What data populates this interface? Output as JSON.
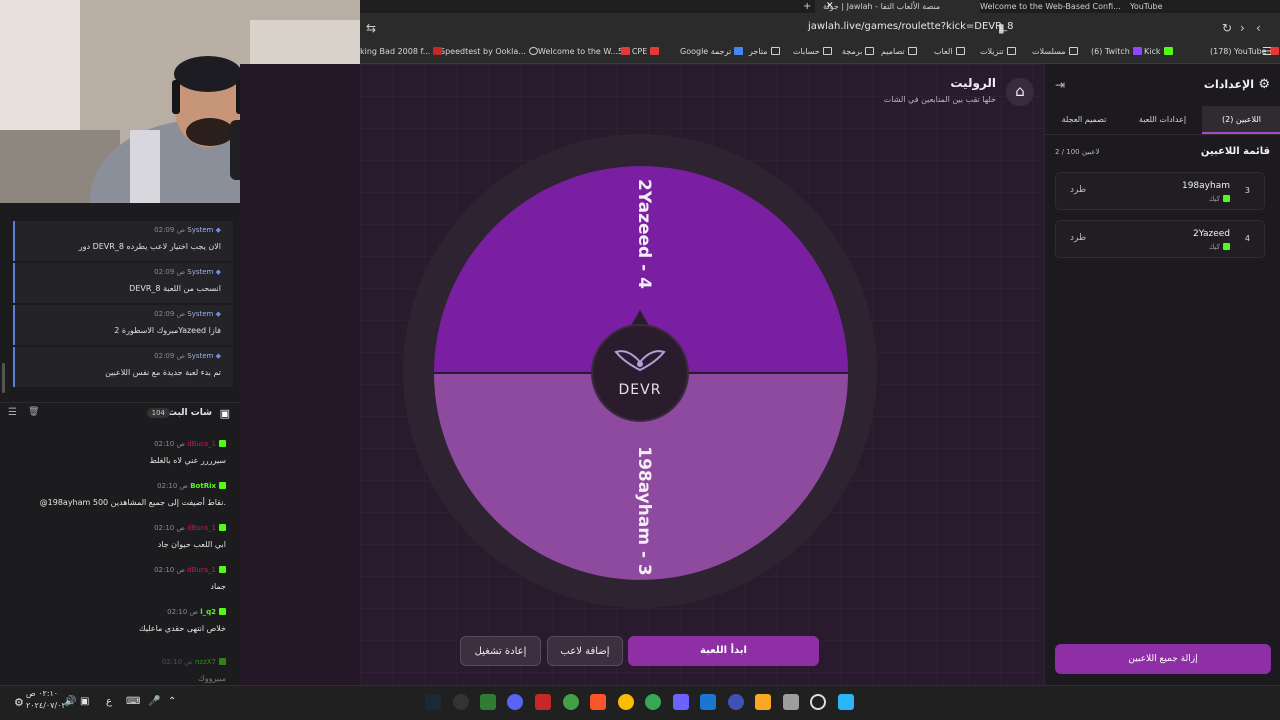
{
  "browser": {
    "tabs": [
      {
        "label": "YouTube"
      },
      {
        "label": "Welcome to the Web-Based Confi..."
      },
      {
        "label": "جولة | Jawlah - منصة الألعاب التفا"
      },
      {
        "label": "+"
      }
    ],
    "url": "jawlah.live/games/roulette?kick=DEVR_8",
    "bookmarks": [
      "(178) YouTube",
      "Kick",
      "(6) Twitch",
      "مسلسلات",
      "تنزيلات",
      "العاب",
      "تصاميم",
      "برمجة",
      "حسابات",
      "متاجر",
      "Google ترجمة",
      "5G CPE",
      "Welcome to the W...",
      "Speedtest by Ookla...",
      "king Bad 2008 f..."
    ]
  },
  "system_messages": [
    {
      "user": "System",
      "time": "02:09 ص",
      "text": "دور DEVR_8 الان يجب اختيار لاعب يطرده"
    },
    {
      "user": "System",
      "time": "02:09 ص",
      "text": "DEVR_8 انسحب من اللعبة"
    },
    {
      "user": "System",
      "time": "02:09 ص",
      "text": "مبروك الاسطورة 2Yazeed فازا"
    },
    {
      "user": "System",
      "time": "02:09 ص",
      "text": "تم بدء لعبة جديدة مع نفس اللاعبين"
    }
  ],
  "chat": {
    "title": "شات البث",
    "count": "104",
    "messages": [
      {
        "user": "dBura_1",
        "time": "02:10 ص",
        "text": "سيرررر عني لاه بالغلط",
        "color": "#c2185b"
      },
      {
        "user": "BotRix",
        "time": "02:10 ص",
        "text": "@198ayham 500 نقاط أضيفت إلى جميع المشاهدين.",
        "color": "#53fc18"
      },
      {
        "user": "dBura_1",
        "time": "02:10 ص",
        "text": "ابي اللعب حيوان جاد",
        "color": "#c2185b"
      },
      {
        "user": "dBura_1",
        "time": "02:10 ص",
        "text": "جماد",
        "color": "#c2185b"
      },
      {
        "user": "l_q2",
        "time": "02:10 ص",
        "text": "خلاص انتهى حقدي ماعليك",
        "color": "#53fc18"
      },
      {
        "user": "nzzX7",
        "time": "02:10 ص",
        "text": "مبيرووك",
        "color": "#53fc18"
      }
    ]
  },
  "game": {
    "title": "الروليت",
    "subtitle": "خلها تقب بين المتابعين في الشات",
    "wheel": {
      "segments": [
        {
          "label": "2Yazeed - 4",
          "color": "#7b1fa2"
        },
        {
          "label": "198ayham - 3",
          "color": "#8e4a9e"
        }
      ],
      "logo": "DEVR"
    },
    "buttons": {
      "start": "ابدأ اللعبة",
      "add_player": "إضافة لاعب",
      "restart": "إعادة تشغيل"
    }
  },
  "settings": {
    "title": "الإعدادات",
    "tabs": [
      "اللاعبين (2)",
      "إعدادات اللعبة",
      "تصميم العجلة"
    ],
    "players_title": "قائمة اللاعبين",
    "players_count": "2 / 100 لاعبين",
    "players": [
      {
        "num": "3",
        "name": "198ayham",
        "platform": "كيك",
        "action": "طرد"
      },
      {
        "num": "4",
        "name": "2Yazeed",
        "platform": "كيك",
        "action": "طرد"
      }
    ],
    "remove_all": "إزالة جميع اللاعبين"
  },
  "taskbar": {
    "time": "٠٢:١٠ ص",
    "date": "٢٠٢٤/٠٧/٠٢",
    "lang": "ع"
  }
}
